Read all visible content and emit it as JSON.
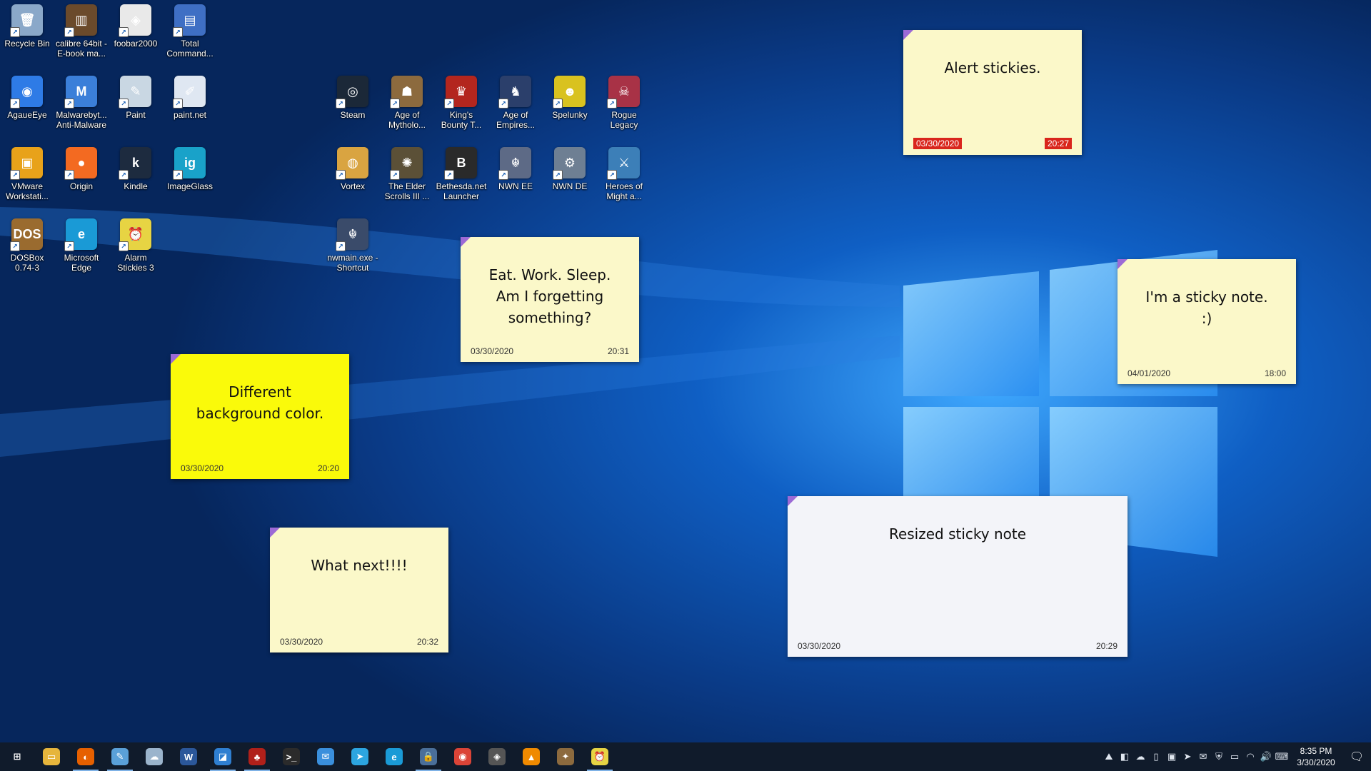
{
  "desktop": {
    "icons": [
      {
        "id": "recycle-bin",
        "label": "Recycle Bin",
        "glyph": "🗑",
        "color": "#8aa8c9",
        "icon": "recycle-bin-icon"
      },
      {
        "id": "calibre",
        "label": "calibre 64bit -\nE-book ma...",
        "glyph": "▥",
        "color": "#6b4a2b",
        "icon": "calibre-icon"
      },
      {
        "id": "foobar2000",
        "label": "foobar2000",
        "glyph": "◈",
        "color": "#e9e9e9",
        "icon": "foobar2000-icon"
      },
      {
        "id": "total-commander",
        "label": "Total\nCommand...",
        "glyph": "▤",
        "color": "#3f6fc4",
        "icon": "floppy-disk-icon"
      },
      {
        "id": "agaueeye",
        "label": "AgaueEye",
        "glyph": "◉",
        "color": "#2e7be6",
        "icon": "agaueeye-icon"
      },
      {
        "id": "malwarebytes",
        "label": "Malwarebyt...\nAnti-Malware",
        "glyph": "M",
        "color": "#3b7fd9",
        "icon": "malwarebytes-icon"
      },
      {
        "id": "paint",
        "label": "Paint",
        "glyph": "✎",
        "color": "#c9d7e3",
        "icon": "paint-palette-icon"
      },
      {
        "id": "paint-net",
        "label": "paint.net",
        "glyph": "✐",
        "color": "#dfe7f2",
        "icon": "paint-net-icon"
      },
      {
        "id": "vmware",
        "label": "VMware\nWorkstati...",
        "glyph": "▣",
        "color": "#e8a21a",
        "icon": "vmware-icon"
      },
      {
        "id": "origin",
        "label": "Origin",
        "glyph": "●",
        "color": "#f36a21",
        "icon": "origin-icon"
      },
      {
        "id": "kindle",
        "label": "Kindle",
        "glyph": "k",
        "color": "#1d2b3f",
        "icon": "kindle-icon"
      },
      {
        "id": "imageglass",
        "label": "ImageGlass",
        "glyph": "ig",
        "color": "#19a2c9",
        "icon": "imageglass-icon"
      },
      {
        "id": "dosbox",
        "label": "DOSBox\n0.74-3",
        "glyph": "DOS",
        "color": "#9a6b2f",
        "icon": "dosbox-icon"
      },
      {
        "id": "edge",
        "label": "Microsoft\nEdge",
        "glyph": "e",
        "color": "#1a9ad6",
        "icon": "edge-icon"
      },
      {
        "id": "alarm-stickies",
        "label": "Alarm\nStickies 3",
        "glyph": "⏰",
        "color": "#e7d443",
        "icon": "alarm-stickies-icon"
      },
      {
        "id": "steam",
        "label": "Steam",
        "glyph": "◎",
        "color": "#1b2838",
        "icon": "steam-icon"
      },
      {
        "id": "age-mythology",
        "label": "Age of\nMytholo...",
        "glyph": "☗",
        "color": "#8c6a3e",
        "icon": "age-of-mythology-icon"
      },
      {
        "id": "kings-bounty",
        "label": "King's\nBounty T...",
        "glyph": "♛",
        "color": "#b3261e",
        "icon": "kings-bounty-icon"
      },
      {
        "id": "age-empires",
        "label": "Age of\nEmpires...",
        "glyph": "♞",
        "color": "#2b3f6b",
        "icon": "age-of-empires-icon"
      },
      {
        "id": "spelunky",
        "label": "Spelunky",
        "glyph": "☻",
        "color": "#d9c21f",
        "icon": "spelunky-icon"
      },
      {
        "id": "rogue-legacy",
        "label": "Rogue\nLegacy",
        "glyph": "☠",
        "color": "#a83246",
        "icon": "rogue-legacy-icon"
      },
      {
        "id": "vortex",
        "label": "Vortex",
        "glyph": "◍",
        "color": "#d9a441",
        "icon": "vortex-icon"
      },
      {
        "id": "elder-scrolls",
        "label": "The Elder\nScrolls III ...",
        "glyph": "✺",
        "color": "#5b5037",
        "icon": "elder-scrolls-icon"
      },
      {
        "id": "bethesda",
        "label": "Bethesda.net\nLauncher",
        "glyph": "B",
        "color": "#2a2a2a",
        "icon": "bethesda-icon"
      },
      {
        "id": "nwn-ee",
        "label": "NWN EE",
        "glyph": "☬",
        "color": "#5d6a86",
        "icon": "nwn-ee-icon"
      },
      {
        "id": "nwn-de",
        "label": "NWN DE",
        "glyph": "⚙",
        "color": "#6e7f93",
        "icon": "nwn-de-icon"
      },
      {
        "id": "heroes",
        "label": "Heroes of\nMight a...",
        "glyph": "⚔",
        "color": "#3c7fb8",
        "icon": "heroes-icon"
      },
      {
        "id": "nwmain",
        "label": "nwmain.exe -\nShortcut",
        "glyph": "☬",
        "color": "#3a4b6a",
        "icon": "nwmain-icon"
      }
    ]
  },
  "notes": [
    {
      "id": "alert",
      "text": "Alert stickies.",
      "date": "03/30/2020",
      "time": "20:27",
      "bg": "#fbf8c9",
      "alert": true
    },
    {
      "id": "eat-work-sleep",
      "text": "Eat. Work. Sleep.\nAm I forgetting\nsomething?",
      "date": "03/30/2020",
      "time": "20:31",
      "bg": "#fbf8c9",
      "alert": false
    },
    {
      "id": "sticky-note",
      "text": "I'm a sticky note.\n:)",
      "date": "04/01/2020",
      "time": "18:00",
      "bg": "#fbf8c9",
      "alert": false
    },
    {
      "id": "different-bg",
      "text": "Different\nbackground color.",
      "date": "03/30/2020",
      "time": "20:20",
      "bg": "#fafa0a",
      "alert": false
    },
    {
      "id": "what-next",
      "text": "What next!!!!",
      "date": "03/30/2020",
      "time": "20:32",
      "bg": "#fbf8c9",
      "alert": false
    },
    {
      "id": "resized",
      "text": "Resized sticky note",
      "date": "03/30/2020",
      "time": "20:29",
      "bg": "#f3f4f9",
      "alert": false
    }
  ],
  "taskbar": {
    "apps": [
      {
        "id": "start",
        "glyph": "⊞",
        "color": "transparent",
        "icon": "windows-start-icon",
        "active": false
      },
      {
        "id": "file-explorer",
        "glyph": "▭",
        "color": "#e6b53c",
        "icon": "file-explorer-icon",
        "active": false
      },
      {
        "id": "firefox",
        "glyph": "◐",
        "color": "#e66000",
        "icon": "firefox-icon",
        "active": true
      },
      {
        "id": "notepad",
        "glyph": "✎",
        "color": "#5aa0d8",
        "icon": "notepad-icon",
        "active": true
      },
      {
        "id": "app4",
        "glyph": "☁",
        "color": "#9bb4cc",
        "icon": "cloud-app-icon",
        "active": false
      },
      {
        "id": "word",
        "glyph": "W",
        "color": "#2b579a",
        "icon": "word-icon",
        "active": false
      },
      {
        "id": "outlook",
        "glyph": "◪",
        "color": "#2f7fd1",
        "icon": "outlook-icon",
        "active": true
      },
      {
        "id": "app7",
        "glyph": "♣",
        "color": "#b0201a",
        "icon": "game-app-icon",
        "active": true
      },
      {
        "id": "terminal",
        "glyph": ">_",
        "color": "#2b2b2b",
        "icon": "terminal-icon",
        "active": false
      },
      {
        "id": "mail",
        "glyph": "✉",
        "color": "#3a8fdc",
        "icon": "mail-icon",
        "active": false
      },
      {
        "id": "telegram",
        "glyph": "➤",
        "color": "#2ca5e0",
        "icon": "telegram-icon",
        "active": false
      },
      {
        "id": "edge",
        "glyph": "e",
        "color": "#1a9ad6",
        "icon": "edge-icon",
        "active": false
      },
      {
        "id": "keepass",
        "glyph": "🔒",
        "color": "#4a6f9a",
        "icon": "lock-app-icon",
        "active": true
      },
      {
        "id": "chrome",
        "glyph": "◉",
        "color": "#db4437",
        "icon": "chrome-icon",
        "active": false
      },
      {
        "id": "foobar",
        "glyph": "◈",
        "color": "#555555",
        "icon": "foobar2000-icon",
        "active": false
      },
      {
        "id": "vlc",
        "glyph": "▲",
        "color": "#f08a00",
        "icon": "vlc-icon",
        "active": false
      },
      {
        "id": "app16",
        "glyph": "✦",
        "color": "#8c6a3e",
        "icon": "horse-app-icon",
        "active": false
      },
      {
        "id": "alarm-stickies",
        "glyph": "⏰",
        "color": "#e7d443",
        "icon": "alarm-stickies-icon",
        "active": true
      }
    ],
    "tray": [
      "⛰",
      "◧",
      "☁",
      "▯",
      "▣",
      "➤",
      "✉",
      "⛨",
      "▭",
      "◠",
      "🔊",
      "⌨"
    ],
    "clock_time": "8:35 PM",
    "clock_date": "3/30/2020"
  }
}
